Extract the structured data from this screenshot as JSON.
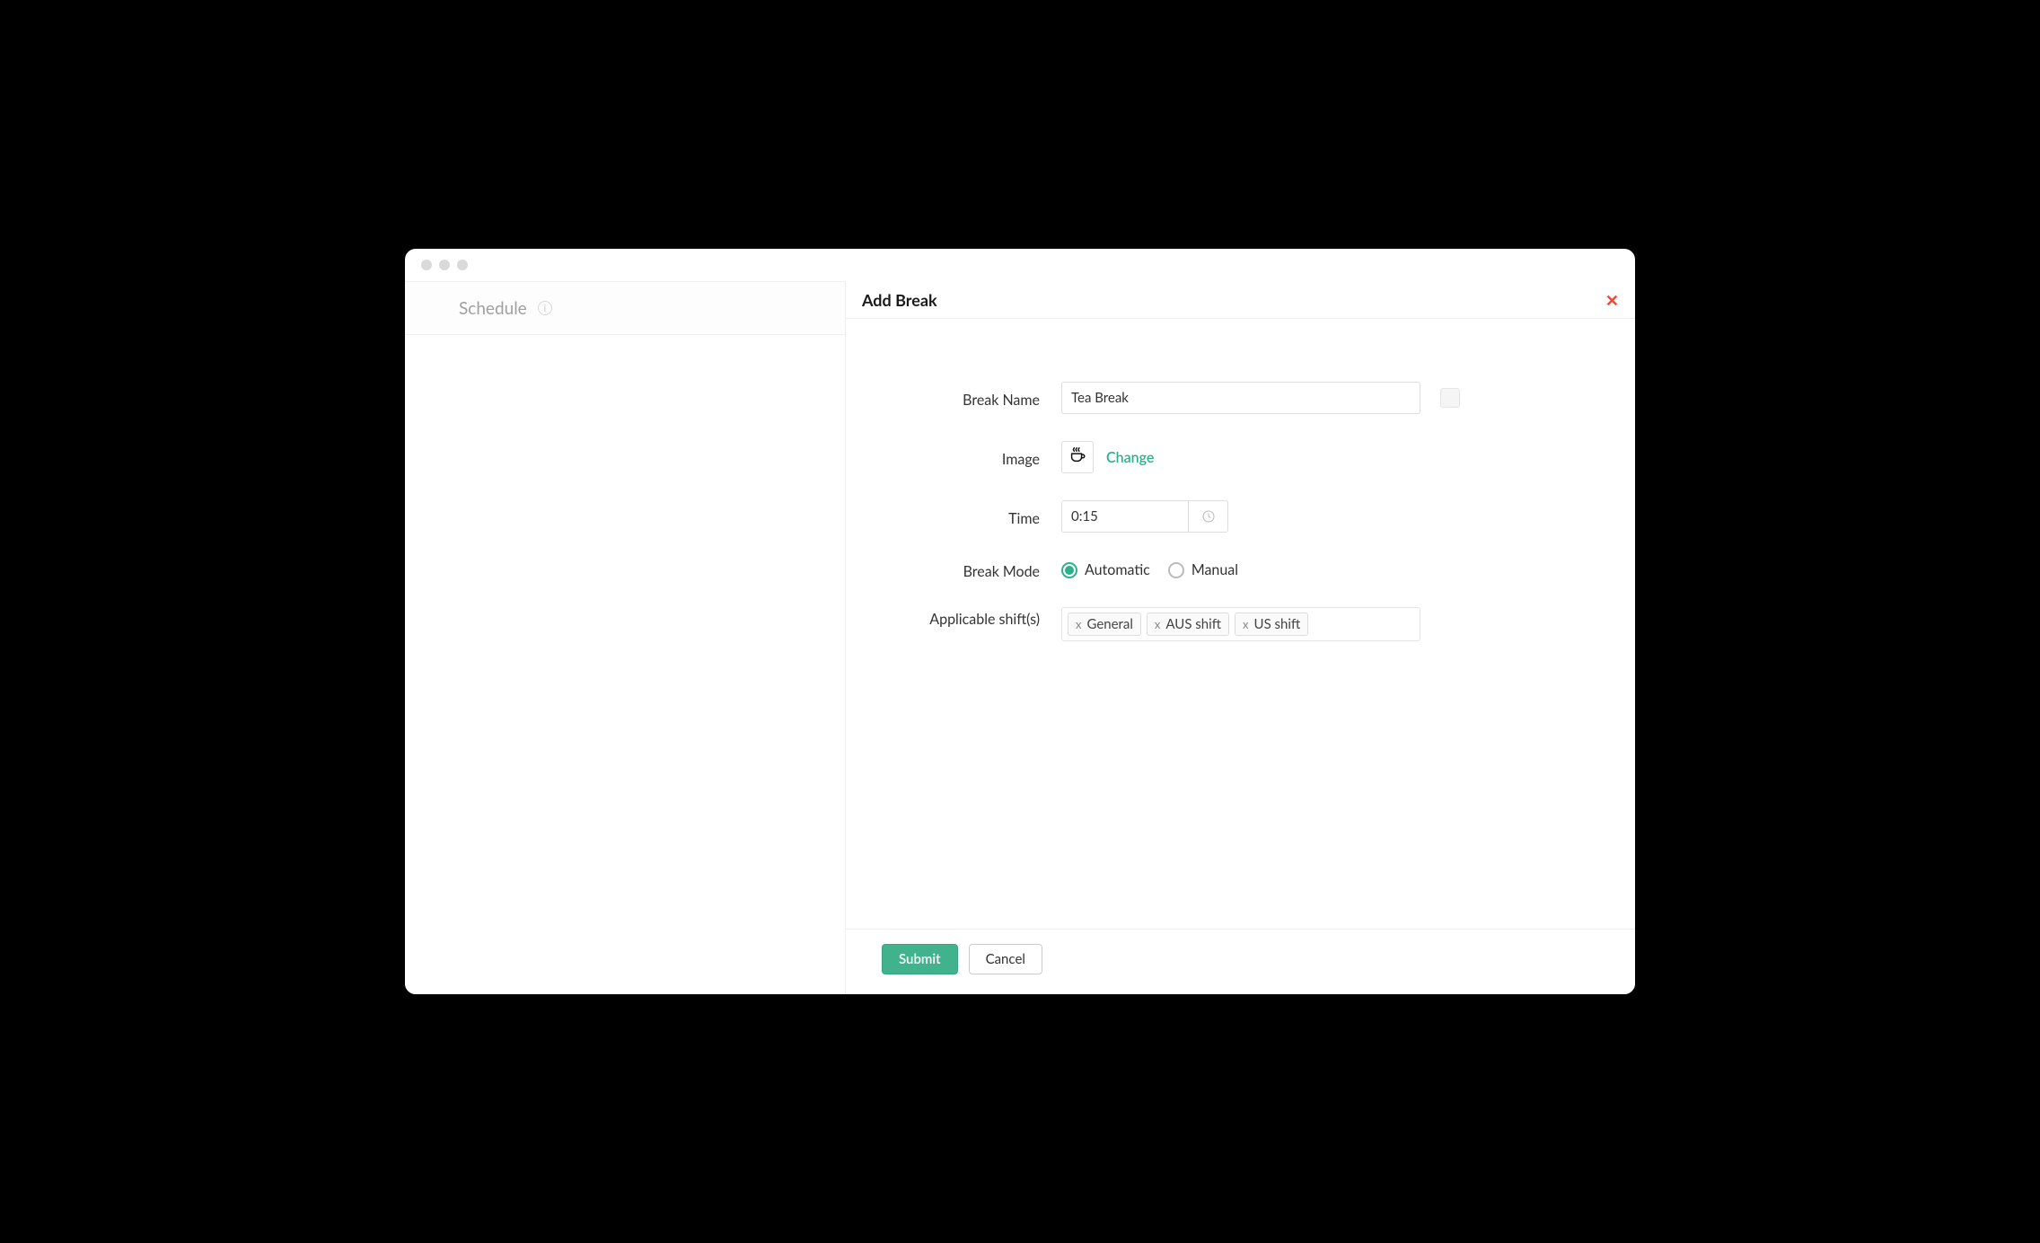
{
  "sidebar": {
    "title": "Schedule"
  },
  "panel": {
    "title": "Add Break"
  },
  "form": {
    "breakName": {
      "label": "Break Name",
      "value": "Tea Break"
    },
    "image": {
      "label": "Image",
      "changeLabel": "Change",
      "icon": "coffee-cup-icon"
    },
    "time": {
      "label": "Time",
      "value": "0:15"
    },
    "breakMode": {
      "label": "Break Mode",
      "options": [
        {
          "label": "Automatic",
          "selected": true
        },
        {
          "label": "Manual",
          "selected": false
        }
      ]
    },
    "shifts": {
      "label": "Applicable shift(s)",
      "items": [
        {
          "label": "General"
        },
        {
          "label": "AUS shift"
        },
        {
          "label": "US shift"
        }
      ]
    }
  },
  "footer": {
    "submit": "Submit",
    "cancel": "Cancel"
  }
}
